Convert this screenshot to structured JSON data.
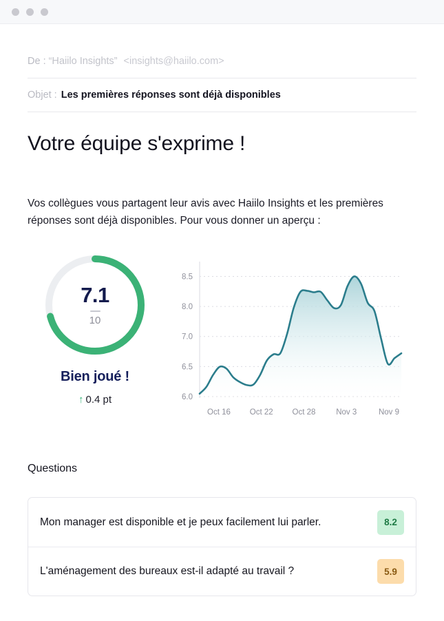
{
  "window": {
    "dots": [
      "close-dot",
      "minimize-dot",
      "maximize-dot"
    ]
  },
  "mail": {
    "from_label": "De :",
    "from_name": "“Haiilo Insights”",
    "from_address": "<insights@haiilo.com>",
    "subject_label": "Objet :",
    "subject_value": "Les premières réponses sont déjà disponibles"
  },
  "content": {
    "title": "Votre équipe s'exprime !",
    "intro": "Vos collègues vous partagent leur avis avec Haiilo Insights et les premières réponses sont déjà disponibles. Pour vous donner un aperçu :"
  },
  "gauge": {
    "score": "7.1",
    "max": "10",
    "percent": 71,
    "caption": "Bien joué !",
    "delta_arrow": "↑",
    "delta_text": "0.4 pt",
    "arc_color": "#3bb276",
    "track_color": "#eceef1",
    "score_color": "#131b4d",
    "delta_color": "#39b37a"
  },
  "questions": {
    "heading": "Questions",
    "items": [
      {
        "text": "Mon manager est disponible et je peux facilement lui parler.",
        "score": "8.2",
        "tone": "green"
      },
      {
        "text": "L'aménagement des bureaux est-il adapté au travail ?",
        "score": "5.9",
        "tone": "orange"
      }
    ]
  },
  "chart_data": {
    "type": "area",
    "title": "",
    "xlabel": "",
    "ylabel": "",
    "line_color": "#2b7d8c",
    "fill_top_color": "#b7d9dd",
    "fill_bottom_color": "#ffffff",
    "grid": true,
    "grid_color": "#dcdce2",
    "legend": "none",
    "ylim": [
      6.0,
      8.75
    ],
    "ytick_labels": [
      "8.5",
      "8.0",
      "7.0",
      "6.5",
      "6.0"
    ],
    "ytick_values": [
      8.5,
      8.0,
      7.5,
      6.5,
      6.0
    ],
    "xtick_labels": [
      "Oct 16",
      "Oct 22",
      "Oct 28",
      "Nov 3",
      "Nov 9"
    ],
    "x": [
      "Oct 13",
      "Oct 14",
      "Oct 15",
      "Oct 16",
      "Oct 17",
      "Oct 18",
      "Oct 19",
      "Oct 20",
      "Oct 21",
      "Oct 22",
      "Oct 23",
      "Oct 24",
      "Oct 25",
      "Oct 26",
      "Oct 27",
      "Oct 28",
      "Oct 29",
      "Oct 30",
      "Oct 31",
      "Nov 1",
      "Nov 2",
      "Nov 3",
      "Nov 4",
      "Nov 5",
      "Nov 6",
      "Nov 7",
      "Nov 8",
      "Nov 9",
      "Nov 10",
      "Nov 11"
    ],
    "values": [
      6.06,
      6.2,
      6.45,
      6.62,
      6.58,
      6.4,
      6.3,
      6.24,
      6.25,
      6.45,
      6.75,
      6.88,
      6.9,
      7.3,
      7.85,
      8.18,
      8.2,
      8.17,
      8.18,
      8.0,
      7.84,
      7.9,
      8.3,
      8.5,
      8.35,
      7.95,
      7.78,
      7.2,
      6.68,
      6.8,
      6.9
    ]
  }
}
